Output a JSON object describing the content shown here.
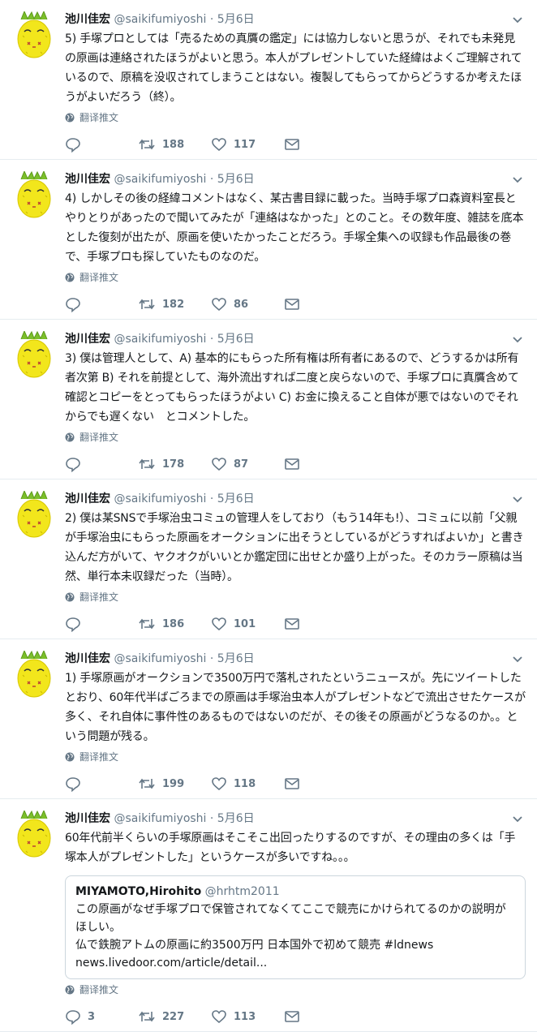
{
  "tweets": [
    {
      "name": "池川佳宏",
      "handle": "@saikifumiyoshi",
      "date": "· 5月6日",
      "text": "5) 手塚プロとしては「売るための真贋の鑑定」には協力しないと思うが、それでも未発見の原画は連絡されたほうがよいと思う。本人がプレゼントしていた経緯はよくご理解されているので、原稿を没収されてしまうことはない。複製してもらってからどうするか考えたほうがよいだろう（終）。",
      "translate": "翻译推文",
      "replies": "",
      "retweets": "188",
      "likes": "117"
    },
    {
      "name": "池川佳宏",
      "handle": "@saikifumiyoshi",
      "date": "· 5月6日",
      "text": "4) しかしその後の経緯コメントはなく、某古書目録に載った。当時手塚プロ森資料室長とやりとりがあったので聞いてみたが「連絡はなかった」とのこと。その数年度、雑誌を底本とした復刻が出たが、原画を使いたかったことだろう。手塚全集への収録も作品最後の巻で、手塚プロも探していたものなのだ。",
      "translate": "翻译推文",
      "replies": "",
      "retweets": "182",
      "likes": "86"
    },
    {
      "name": "池川佳宏",
      "handle": "@saikifumiyoshi",
      "date": "· 5月6日",
      "text": "3) 僕は管理人として、A) 基本的にもらった所有権は所有者にあるので、どうするかは所有者次第 B) それを前提として、海外流出すれば二度と戻らないので、手塚プロに真贋含めて確認とコピーをとってもらったほうがよい C) お金に換えること自体が悪ではないのでそれからでも遅くない　とコメントした。",
      "translate": "翻译推文",
      "replies": "",
      "retweets": "178",
      "likes": "87"
    },
    {
      "name": "池川佳宏",
      "handle": "@saikifumiyoshi",
      "date": "· 5月6日",
      "text": "2) 僕は某SNSで手塚治虫コミュの管理人をしており（もう14年も!）、コミュに以前「父親が手塚治虫にもらった原画をオークションに出そうとしているがどうすればよいか」と書き込んだ方がいて、ヤクオクがいいとか鑑定団に出せとか盛り上がった。そのカラー原稿は当然、単行本未収録だった（当時）。",
      "translate": "翻译推文",
      "replies": "",
      "retweets": "186",
      "likes": "101"
    },
    {
      "name": "池川佳宏",
      "handle": "@saikifumiyoshi",
      "date": "· 5月6日",
      "text": "1) 手塚原画がオークションで3500万円で落札されたというニュースが。先にツイートしたとおり、60年代半ばごろまでの原画は手塚治虫本人がプレゼントなどで流出させたケースが多く、それ自体に事件性のあるものではないのだが、その後その原画がどうなるのか。。という問題が残る。",
      "translate": "翻译推文",
      "replies": "",
      "retweets": "199",
      "likes": "118"
    },
    {
      "name": "池川佳宏",
      "handle": "@saikifumiyoshi",
      "date": "· 5月6日",
      "text": "60年代前半くらいの手塚原画はそこそこ出回ったりするのですが、その理由の多くは「手塚本人がプレゼントした」というケースが多いですね。。。",
      "translate": "翻译推文",
      "replies": "3",
      "retweets": "227",
      "likes": "113",
      "quote": {
        "name": "MIYAMOTO,Hirohito",
        "handle": "@hrhtm2011",
        "text": "この原画がなぜ手塚プロで保管されてなくてここで競売にかけられてるのかの説明がほしい。\n仏で鉄腕アトムの原画に約3500万円 日本国外で初めて競売 #ldnews\nnews.livedoor.com/article/detail..."
      }
    }
  ],
  "colors": {
    "accent": "#1da1f2",
    "muted": "#657786",
    "text": "#14171a",
    "border": "#e6ecf0"
  },
  "icons": [
    "pineapple-avatar-icon",
    "chevron-down-icon",
    "globe-icon",
    "reply-icon",
    "retweet-icon",
    "like-icon",
    "message-icon"
  ]
}
